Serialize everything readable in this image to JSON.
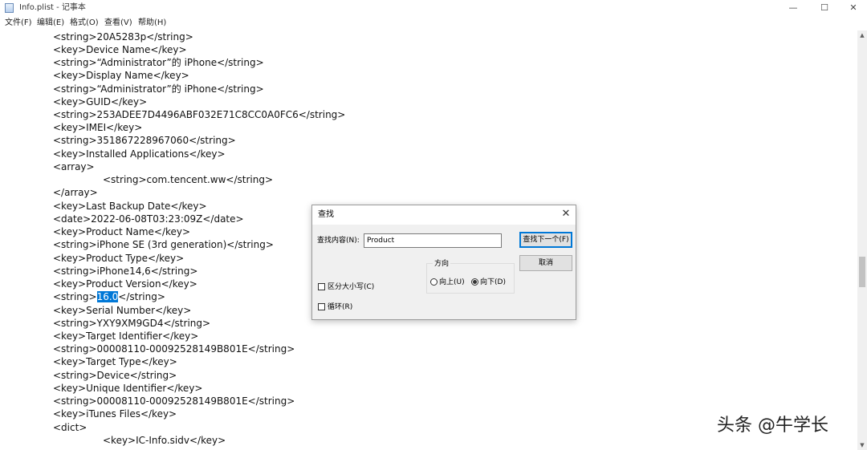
{
  "window": {
    "title": "Info.plist - 记事本",
    "minimize_glyph": "—",
    "maximize_glyph": "☐",
    "close_glyph": "✕"
  },
  "menu": [
    "文件(F)",
    "编辑(E)",
    "格式(O)",
    "查看(V)",
    "帮助(H)"
  ],
  "editor": {
    "lines": [
      "<string>20A5283p</string>",
      "<key>Device Name</key>",
      "<string>“Administrator”的 iPhone</string>",
      "<key>Display Name</key>",
      "<string>“Administrator”的 iPhone</string>",
      "<key>GUID</key>",
      "<string>253ADEE7D4496ABF032E71C8CC0A0FC6</string>",
      "<key>IMEI</key>",
      "<string>351867228967060</string>",
      "<key>Installed Applications</key>",
      "<array>",
      "<string>com.tencent.ww</string>",
      "</array>",
      "<key>Last Backup Date</key>",
      "<date>2022-06-08T03:23:09Z</date>",
      "<key>Product Name</key>",
      "<string>iPhone SE (3rd generation)</string>",
      "<key>Product Type</key>",
      "<string>iPhone14,6</string>",
      "<key>Product Version</key>",
      "",
      "<key>Serial Number</key>",
      "<string>YXY9XM9GD4</string>",
      "<key>Target Identifier</key>",
      "<string>00008110-00092528149B801E</string>",
      "<key>Target Type</key>",
      "<string>Device</string>",
      "<key>Unique Identifier</key>",
      "<string>00008110-00092528149B801E</string>",
      "<key>iTunes Files</key>",
      "<dict>",
      "<key>IC-Info.sidv</key>"
    ],
    "selected_line": {
      "before": "<string>",
      "selected": "16.0",
      "after": "</string>"
    }
  },
  "find_dialog": {
    "title": "查找",
    "find_label": "查找内容(N):",
    "find_value": "Product",
    "find_next_button": "查找下一个(F)",
    "cancel_button": "取消",
    "direction_label": "方向",
    "direction_up": "向上(U)",
    "direction_down": "向下(D)",
    "selected_direction": "down",
    "match_case": "区分大小写(C)",
    "match_case_checked": false,
    "wrap_around": "循环(R)",
    "wrap_around_checked": false,
    "close_glyph": "✕"
  },
  "watermark": "头条 @牛学长",
  "colors": {
    "selection": "#0078d7",
    "dialog_bg": "#f0f0f0",
    "default_button_border": "#0078d7"
  }
}
